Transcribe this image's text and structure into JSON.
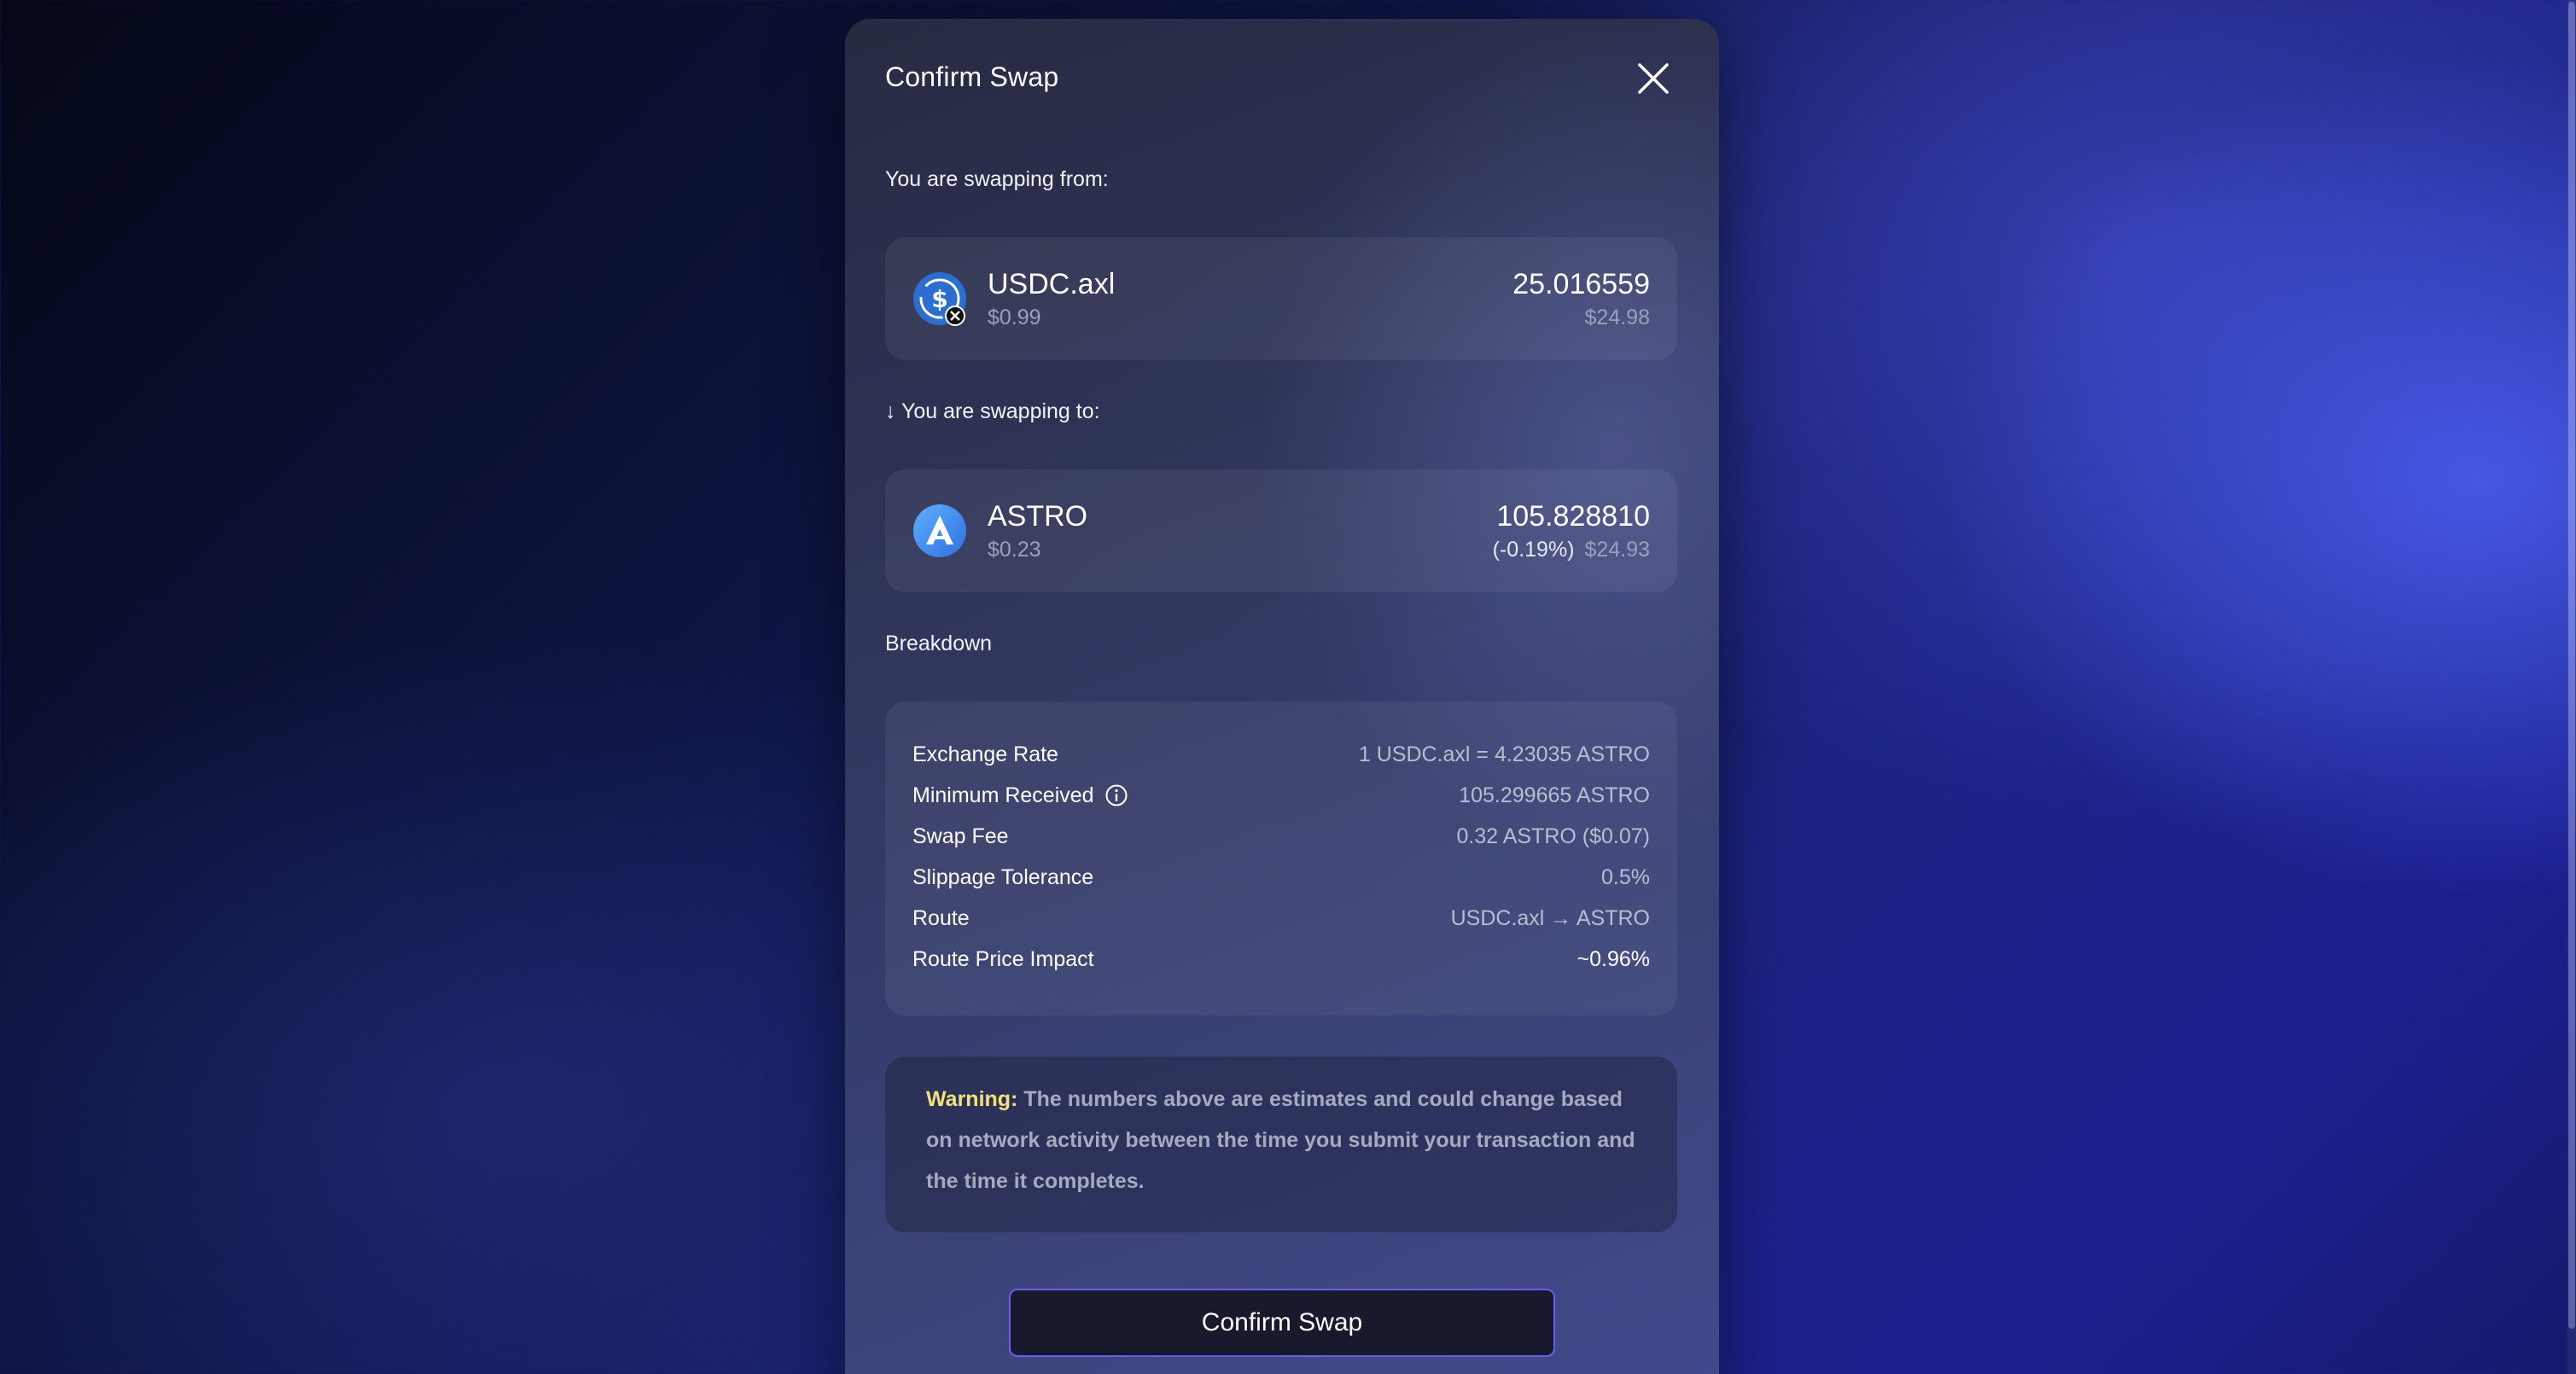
{
  "modal": {
    "title": "Confirm Swap"
  },
  "from": {
    "label": "You are swapping from:",
    "symbol": "USDC.axl",
    "price": "$0.99",
    "amount": "25.016559",
    "usd_value": "$24.98",
    "icon": "usdc-axl-token-icon"
  },
  "to": {
    "arrow": "↓",
    "label": "You are swapping to:",
    "symbol": "ASTRO",
    "price": "$0.23",
    "amount": "105.828810",
    "price_impact": "(-0.19%)",
    "usd_value": "$24.93",
    "icon": "astro-token-icon"
  },
  "breakdown": {
    "title": "Breakdown",
    "rows": [
      {
        "label": "Exchange Rate",
        "value": "1 USDC.axl = 4.23035 ASTRO"
      },
      {
        "label": "Minimum Received",
        "value": "105.299665 ASTRO"
      },
      {
        "label": "Swap Fee",
        "value": "0.32 ASTRO ($0.07)"
      },
      {
        "label": "Slippage Tolerance",
        "value": "0.5%"
      },
      {
        "label": "Route",
        "value": "USDC.axl → ASTRO"
      },
      {
        "label": "Route Price Impact",
        "value": "~0.96%"
      }
    ]
  },
  "warning": {
    "prefix": "Warning:",
    "text": "The numbers above are estimates and could change based on network activity between the time you submit your transaction and the time it completes."
  },
  "actions": {
    "confirm_label": "Confirm Swap"
  },
  "colors": {
    "accent_border": "#6a5cf0",
    "warning_prefix": "#f2e27a",
    "muted_text": "#9aa0b8"
  }
}
